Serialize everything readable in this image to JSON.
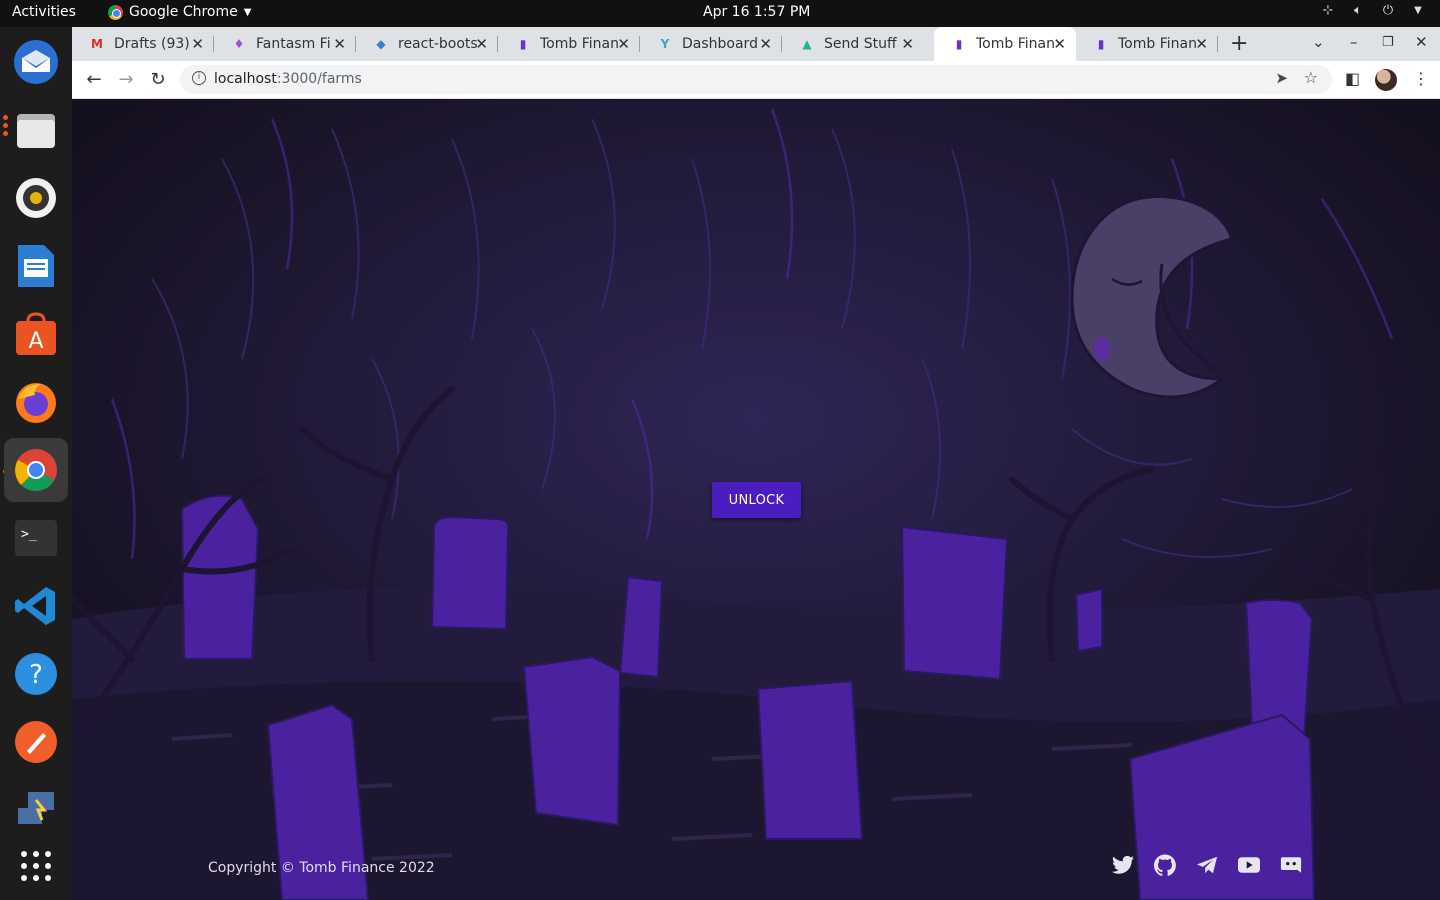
{
  "system": {
    "activities": "Activities",
    "app_name": "Google Chrome",
    "clock": "Apr 16  1:57 PM"
  },
  "dock": {
    "items": [
      "thunderbird-icon",
      "files-icon",
      "rhythmbox-icon",
      "writer-icon",
      "software-icon",
      "firefox-icon",
      "chrome-icon",
      "terminal-icon",
      "vscode-icon",
      "help-icon",
      "inkscape-icon",
      "remote-icon",
      "apps-grid-icon"
    ]
  },
  "browser": {
    "tabs": [
      {
        "title": "Drafts (93)",
        "icon": "gmail-icon"
      },
      {
        "title": "Fantasm Fi",
        "icon": "fantasm-icon"
      },
      {
        "title": "react-boots",
        "icon": "react-bootstrap-icon"
      },
      {
        "title": "Tomb Finan",
        "icon": "tomb-icon"
      },
      {
        "title": "Dashboard",
        "icon": "dashboard-icon"
      },
      {
        "title": "Send Stuff",
        "icon": "send-stuff-icon"
      },
      {
        "title": "Tomb Finan",
        "icon": "tomb-icon",
        "active": true
      },
      {
        "title": "Tomb Finan",
        "icon": "tomb-icon"
      }
    ],
    "url_host": "localhost",
    "url_path": ":3000/farms"
  },
  "page": {
    "unlock_label": "UNLOCK",
    "copyright": "Copyright © Tomb Finance 2022",
    "socials": [
      "twitter-icon",
      "github-icon",
      "telegram-icon",
      "youtube-icon",
      "discord-icon"
    ],
    "colors": {
      "accent": "#4a1dc0",
      "background": "#211a3d"
    }
  }
}
